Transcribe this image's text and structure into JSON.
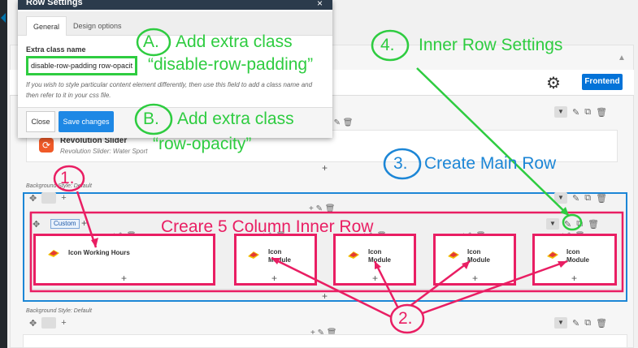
{
  "modal": {
    "title": "Row Settings",
    "close_glyph": "×",
    "tabs": [
      "General",
      "Design options"
    ],
    "field_label": "Extra class name",
    "field_value": "disable-row-padding row-opacity",
    "help_text": "If you wish to style particular content element differently, then use this field to add a class name and then refer to it in your css file.",
    "buttons": {
      "close": "Close",
      "save": "Save changes"
    }
  },
  "toolbar": {
    "frontend_label": "Frontend",
    "settings_icon": "gear-icon"
  },
  "rows": {
    "revolution": {
      "title": "Revolution Slider",
      "subtitle": "Revolution Slider: Water Sport"
    },
    "background_style_1": "Background Style: Default",
    "background_style_2": "Background Style: Default",
    "custom_badge": "Custom"
  },
  "columns": [
    {
      "title": "Icon Working Hours"
    },
    {
      "title": "Icon Module"
    },
    {
      "title": "Icon Module"
    },
    {
      "title": "Icon Module"
    },
    {
      "title": "Icon Module"
    }
  ],
  "annotations": {
    "a_letter": "A.",
    "a_text": "Add extra class",
    "a_sub": "“disable-row-padding”",
    "b_letter": "B.",
    "b_text": "Add extra class",
    "b_sub": "“row-opacity”",
    "four_letter": "4.",
    "four_text": "Inner Row Settings",
    "three_letter": "3.",
    "three_text": "Create Main Row",
    "one_letter": "1.",
    "two_letter": "2.",
    "inner_row": "Creare 5 Column Inner Row"
  },
  "colors": {
    "green": "#2ecc40",
    "blue": "#1c86d6",
    "pink": "#e91e63",
    "primary_button": "#1e88e5"
  }
}
